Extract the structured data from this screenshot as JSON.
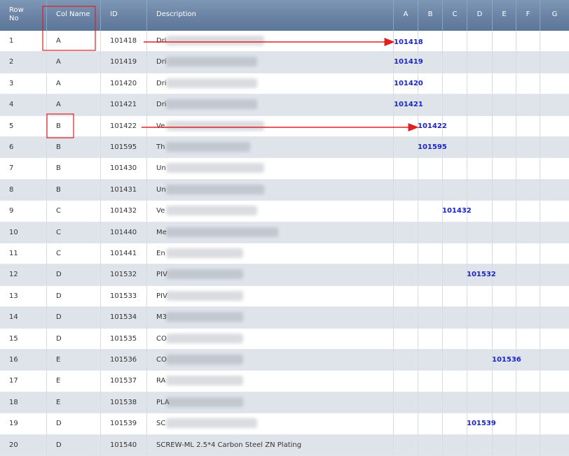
{
  "headers": {
    "row_no": "Row No",
    "row_no_line1": "Row",
    "row_no_line2": "No",
    "col_name": "Col Name",
    "id": "ID",
    "description": "Description",
    "letters": [
      "A",
      "B",
      "C",
      "D",
      "E",
      "F",
      "G"
    ]
  },
  "rows": [
    {
      "row_no": "1",
      "col_name": "A",
      "id": "101418",
      "desc_prefix": "Dri",
      "placed_col": "A",
      "placed_value": "101418"
    },
    {
      "row_no": "2",
      "col_name": "A",
      "id": "101419",
      "desc_prefix": "Dri",
      "placed_col": "A",
      "placed_value": "101419"
    },
    {
      "row_no": "3",
      "col_name": "A",
      "id": "101420",
      "desc_prefix": "Dri",
      "placed_col": "A",
      "placed_value": "101420"
    },
    {
      "row_no": "4",
      "col_name": "A",
      "id": "101421",
      "desc_prefix": "Dri",
      "placed_col": "A",
      "placed_value": "101421"
    },
    {
      "row_no": "5",
      "col_name": "B",
      "id": "101422",
      "desc_prefix": "Ve",
      "placed_col": "B",
      "placed_value": "101422"
    },
    {
      "row_no": "6",
      "col_name": "B",
      "id": "101595",
      "desc_prefix": "Th",
      "placed_col": "B",
      "placed_value": "101595"
    },
    {
      "row_no": "7",
      "col_name": "B",
      "id": "101430",
      "desc_prefix": "Un",
      "placed_col": "",
      "placed_value": ""
    },
    {
      "row_no": "8",
      "col_name": "B",
      "id": "101431",
      "desc_prefix": "Un",
      "placed_col": "",
      "placed_value": ""
    },
    {
      "row_no": "9",
      "col_name": "C",
      "id": "101432",
      "desc_prefix": "Ve",
      "placed_col": "C",
      "placed_value": "101432"
    },
    {
      "row_no": "10",
      "col_name": "C",
      "id": "101440",
      "desc_prefix": "Me",
      "placed_col": "",
      "placed_value": ""
    },
    {
      "row_no": "11",
      "col_name": "C",
      "id": "101441",
      "desc_prefix": "En",
      "placed_col": "",
      "placed_value": ""
    },
    {
      "row_no": "12",
      "col_name": "D",
      "id": "101532",
      "desc_prefix": "PIV",
      "placed_col": "D",
      "placed_value": "101532"
    },
    {
      "row_no": "13",
      "col_name": "D",
      "id": "101533",
      "desc_prefix": "PIV",
      "placed_col": "",
      "placed_value": ""
    },
    {
      "row_no": "14",
      "col_name": "D",
      "id": "101534",
      "desc_prefix": "M3",
      "placed_col": "",
      "placed_value": ""
    },
    {
      "row_no": "15",
      "col_name": "D",
      "id": "101535",
      "desc_prefix": "CO",
      "placed_col": "",
      "placed_value": ""
    },
    {
      "row_no": "16",
      "col_name": "E",
      "id": "101536",
      "desc_prefix": "CO",
      "placed_col": "E",
      "placed_value": "101536"
    },
    {
      "row_no": "17",
      "col_name": "E",
      "id": "101537",
      "desc_prefix": "RA",
      "placed_col": "",
      "placed_value": ""
    },
    {
      "row_no": "18",
      "col_name": "E",
      "id": "101538",
      "desc_prefix": "PLA",
      "placed_col": "",
      "placed_value": ""
    },
    {
      "row_no": "19",
      "col_name": "D",
      "id": "101539",
      "desc_prefix": "SC",
      "placed_col": "D",
      "placed_value": "101539"
    },
    {
      "row_no": "20",
      "col_name": "D",
      "id": "101540",
      "desc_prefix": "SCREW-ML 2.5*4 Carbon Steel ZN Plating",
      "placed_col": "",
      "placed_value": ""
    }
  ],
  "colors": {
    "header_bg": "#6a83a5",
    "alt_row_bg": "#dfe4ea",
    "placed_text": "#1a25c4",
    "annotation_red": "#e02020"
  }
}
